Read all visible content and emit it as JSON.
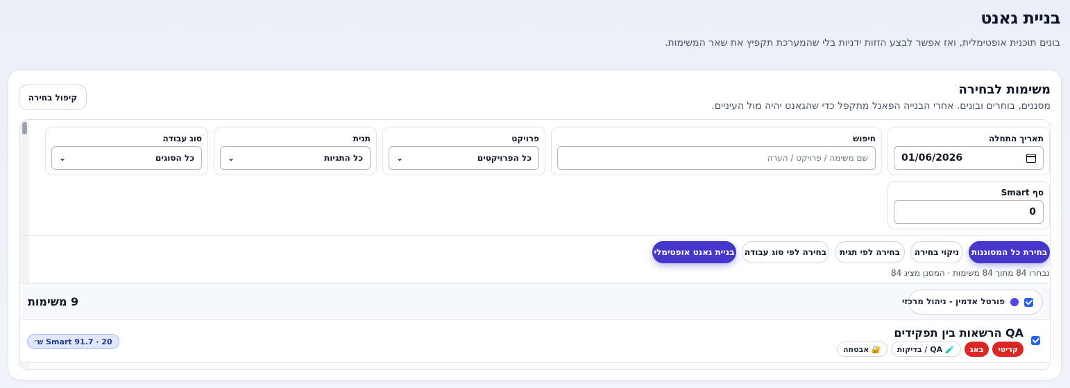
{
  "header": {
    "title": "בניית גאנט",
    "subtitle": "בונים תוכנית אופטימלית, ואז אפשר לבצע הזזות ידניות בלי שהמערכת תקפיץ את שאר המשימות."
  },
  "panel": {
    "title": "משימות לבחירה",
    "subtitle": "מסננים, בוחרים ובונים. אחרי הבנייה הפאנל מתקפל כדי שהגאנט יהיה מול העיניים.",
    "collapse_label": "קיפול בחירה"
  },
  "filters": {
    "start_date": {
      "label": "תאריך התחלה",
      "value": "01/06/2026"
    },
    "search": {
      "label": "חיפוש",
      "placeholder": "שם משימה / פרויקט / הערה"
    },
    "project": {
      "label": "פרויקט",
      "value": "כל הפרויקטים"
    },
    "tag": {
      "label": "תגית",
      "value": "כל התגיות"
    },
    "work_type": {
      "label": "סוג עבודה",
      "value": "כל הסוגים"
    },
    "smart_threshold": {
      "label": "סף Smart",
      "value": "0"
    }
  },
  "actions": {
    "select_all_filtered": "בחירת כל המסוננות",
    "clear_selection": "ניקוי בחירה",
    "select_by_tag": "בחירה לפי תגית",
    "select_by_work_type": "בחירה לפי סוג עבודה",
    "build_optimal": "בניית גאנט אופטימלי"
  },
  "selection_summary": "נבחרו 84 מתוך 84 משימות · המסנן מציג 84",
  "groups": [
    {
      "name": "פורטל אדמין - ניהול מרכזי",
      "count_label": "9 משימות",
      "color": "#4f46e5",
      "tasks": [
        {
          "title": "QA הרשאות בין תפקידים",
          "tags": [
            "קריטי",
            "באג",
            "🧪 QA / בדיקות",
            "🔐 אבטחה"
          ],
          "smart_badge": "20 · Smart 91.7 ש׳"
        }
      ]
    }
  ],
  "colors": {
    "primary": "#4338ca",
    "critical": "#dc2626",
    "checkbox": "#2563eb"
  }
}
